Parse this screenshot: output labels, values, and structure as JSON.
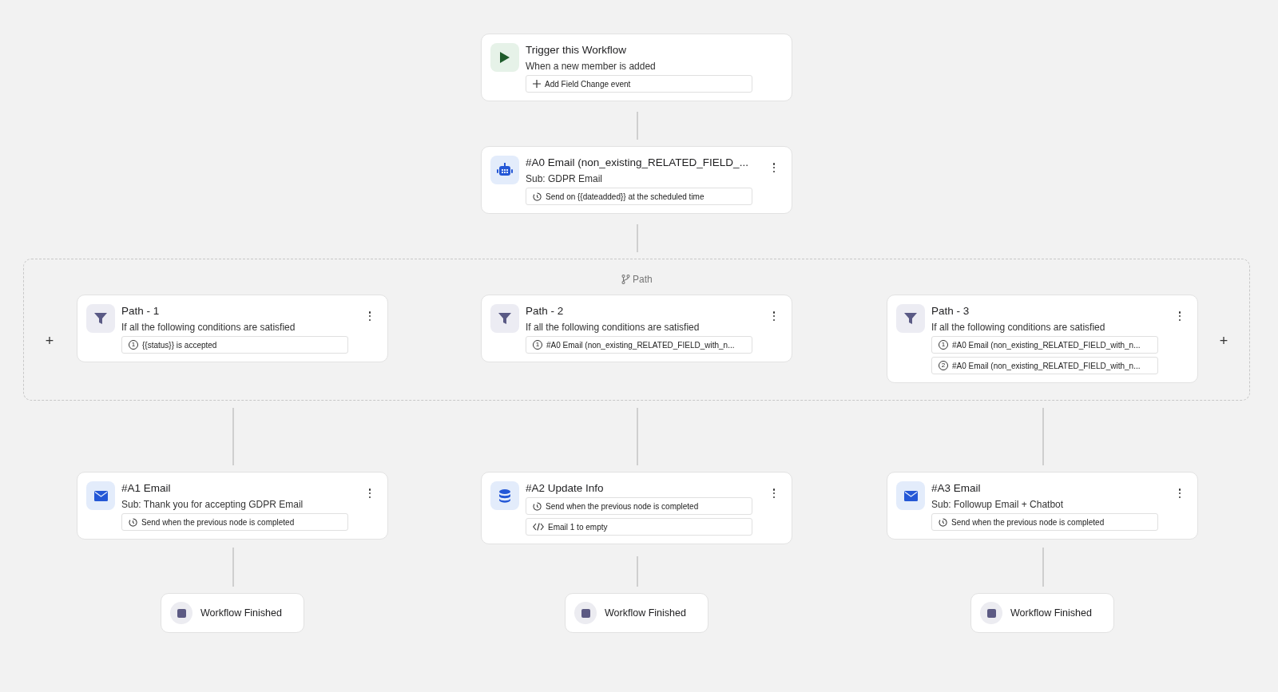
{
  "top_nodes": [
    {
      "kind": "play",
      "title": "Trigger this Workflow",
      "subtitle": "When a new member is added",
      "menu": false,
      "chips": [
        {
          "kind": "plus",
          "text": "Add Field Change event"
        }
      ]
    },
    {
      "kind": "robot",
      "title": "#A0 Email (non_existing_RELATED_FIELD_...",
      "subtitle": "Sub: GDPR Email",
      "menu": true,
      "chips": [
        {
          "kind": "clock",
          "text": "Send on {{dateadded}} at the scheduled time"
        }
      ]
    }
  ],
  "path_group": {
    "label": "Path",
    "add_buttons": [
      "+",
      "+"
    ],
    "branches": [
      {
        "condition": {
          "kind": "funnel",
          "title": "Path - 1",
          "subtitle": "If all the following conditions are satisfied",
          "menu": true,
          "chips": [
            {
              "kind": "number",
              "number": "1",
              "text": "{{status}} is accepted"
            }
          ]
        },
        "action": {
          "kind": "mail",
          "title": "#A1 Email",
          "subtitle": "Sub: Thank you for accepting GDPR Email",
          "menu": true,
          "chips": [
            {
              "kind": "clock",
              "text": "Send when the previous node is completed"
            }
          ]
        },
        "end": {
          "label": "Workflow Finished"
        }
      },
      {
        "condition": {
          "kind": "funnel",
          "title": "Path - 2",
          "subtitle": "If all the following conditions are satisfied",
          "menu": true,
          "chips": [
            {
              "kind": "number",
              "number": "1",
              "text": "#A0 Email (non_existing_RELATED_FIELD_with_n..."
            }
          ]
        },
        "action": {
          "kind": "database",
          "title": "#A2 Update Info",
          "menu": true,
          "chips": [
            {
              "kind": "clock",
              "text": "Send when the previous node is completed"
            },
            {
              "kind": "code",
              "text": "Email 1 to empty"
            }
          ]
        },
        "end": {
          "label": "Workflow Finished"
        }
      },
      {
        "condition": {
          "kind": "funnel",
          "title": "Path - 3",
          "subtitle": "If all the following conditions are satisfied",
          "menu": true,
          "chips": [
            {
              "kind": "number",
              "number": "1",
              "text": "#A0 Email (non_existing_RELATED_FIELD_with_n..."
            },
            {
              "kind": "number",
              "number": "2",
              "text": "#A0 Email (non_existing_RELATED_FIELD_with_n..."
            }
          ]
        },
        "action": {
          "kind": "mail",
          "title": "#A3 Email",
          "subtitle": "Sub: Followup Email + Chatbot",
          "menu": true,
          "chips": [
            {
              "kind": "clock",
              "text": "Send when the previous node is completed"
            }
          ]
        },
        "end": {
          "label": "Workflow Finished"
        }
      }
    ]
  }
}
